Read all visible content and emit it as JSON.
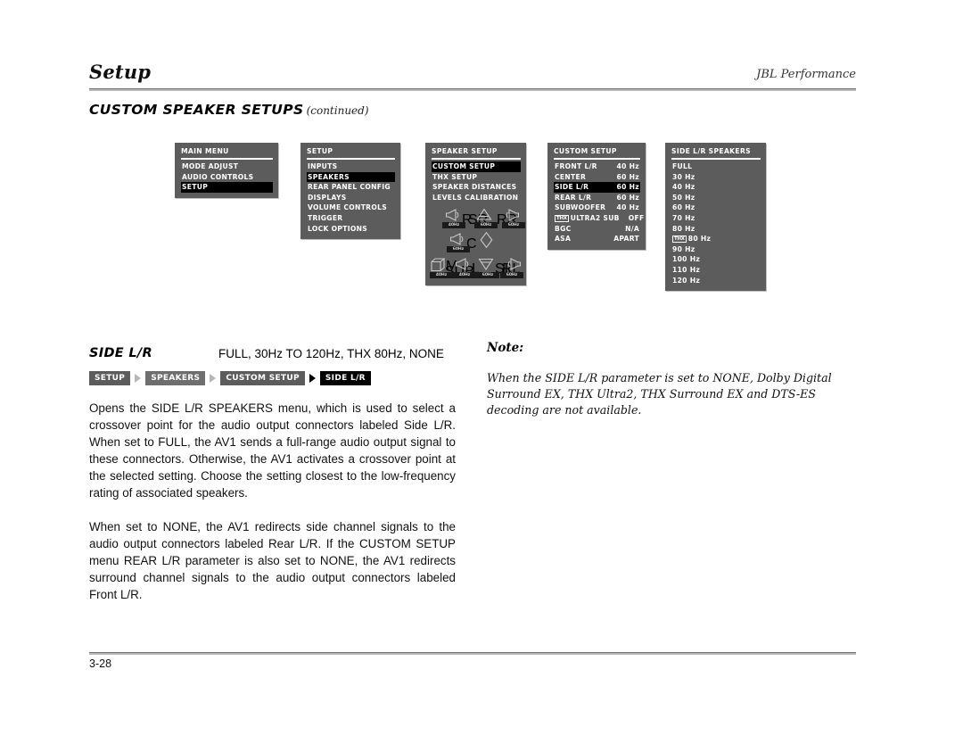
{
  "header": {
    "title": "Setup",
    "brand": "JBL Performance"
  },
  "section": {
    "heading": "CUSTOM SPEAKER SETUPS",
    "continued": "(continued)"
  },
  "menus": [
    {
      "id": "main-menu",
      "title": "MAIN MENU",
      "rows": [
        {
          "label": "MODE ADJUST",
          "value": "",
          "selected": false
        },
        {
          "label": "AUDIO CONTROLS",
          "value": "",
          "selected": false
        },
        {
          "label": "SETUP",
          "value": "",
          "selected": true
        }
      ]
    },
    {
      "id": "setup-menu",
      "title": "SETUP",
      "rows": [
        {
          "label": "INPUTS",
          "value": "",
          "selected": false
        },
        {
          "label": "SPEAKERS",
          "value": "",
          "selected": true
        },
        {
          "label": "REAR PANEL CONFIG",
          "value": "",
          "selected": false
        },
        {
          "label": "DISPLAYS",
          "value": "",
          "selected": false
        },
        {
          "label": "VOLUME CONTROLS",
          "value": "",
          "selected": false
        },
        {
          "label": "TRIGGER",
          "value": "",
          "selected": false
        },
        {
          "label": "LOCK OPTIONS",
          "value": "",
          "selected": false
        }
      ]
    },
    {
      "id": "speaker-setup-menu",
      "title": "SPEAKER SETUP",
      "rows": [
        {
          "label": "CUSTOM SETUP",
          "value": "",
          "selected": true
        },
        {
          "label": "THX SETUP",
          "value": "",
          "selected": false
        },
        {
          "label": "SPEAKER DISTANCES",
          "value": "",
          "selected": false
        },
        {
          "label": "LEVELS CALIBRATION",
          "value": "",
          "selected": false
        }
      ],
      "diagram": {
        "speakers": [
          {
            "name": "R",
            "crossover": "40Hz"
          },
          {
            "name": "SR",
            "crossover": "60Hz"
          },
          {
            "name": "RR",
            "crossover": "60Hz"
          },
          {
            "name": "C",
            "crossover": "60Hz"
          },
          {
            "name": "SUB",
            "crossover": "40Hz"
          },
          {
            "name": "L",
            "crossover": "40Hz"
          },
          {
            "name": "SL",
            "crossover": "60Hz"
          },
          {
            "name": "RL",
            "crossover": "60Hz"
          }
        ],
        "sub_prefix": "M"
      }
    },
    {
      "id": "custom-setup-menu",
      "title": "CUSTOM SETUP",
      "rows": [
        {
          "label": "FRONT L/R",
          "value": "40 Hz",
          "selected": false
        },
        {
          "label": "CENTER",
          "value": "60 Hz",
          "selected": false
        },
        {
          "label": "SIDE L/R",
          "value": "60 Hz",
          "selected": true
        },
        {
          "label": "REAR L/R",
          "value": "60 Hz",
          "selected": false
        },
        {
          "label": "SUBWOOFER",
          "value": "40 Hz",
          "selected": false
        },
        {
          "label": "ULTRA2 SUB",
          "value": "OFF",
          "selected": false,
          "badge": "THX"
        },
        {
          "label": "BGC",
          "value": "N/A",
          "selected": false
        },
        {
          "label": "ASA",
          "value": "APART",
          "selected": false
        }
      ]
    },
    {
      "id": "side-lr-speakers-menu",
      "title": "SIDE L/R SPEAKERS",
      "rows": [
        {
          "label": "FULL",
          "value": "",
          "selected": false
        },
        {
          "label": "30 Hz",
          "value": "",
          "selected": false
        },
        {
          "label": "40 Hz",
          "value": "",
          "selected": false
        },
        {
          "label": "50 Hz",
          "value": "",
          "selected": false
        },
        {
          "label": "60 Hz",
          "value": "",
          "selected": false
        },
        {
          "label": "70 Hz",
          "value": "",
          "selected": false
        },
        {
          "label": "80 Hz",
          "value": "",
          "selected": false
        },
        {
          "label": "80 Hz",
          "value": "",
          "selected": false,
          "badge": "THX"
        },
        {
          "label": "90 Hz",
          "value": "",
          "selected": false
        },
        {
          "label": "100 Hz",
          "value": "",
          "selected": false
        },
        {
          "label": "110 Hz",
          "value": "",
          "selected": false
        },
        {
          "label": "120 Hz",
          "value": "",
          "selected": false
        }
      ]
    }
  ],
  "parameter": {
    "name": "SIDE L/R",
    "values": "FULL, 30Hz TO 120Hz, THX 80Hz, NONE"
  },
  "breadcrumb": [
    {
      "label": "SETUP",
      "style": "dark"
    },
    {
      "label": "SPEAKERS",
      "style": "light"
    },
    {
      "label": "CUSTOM SETUP",
      "style": "dark"
    },
    {
      "label": "SIDE L/R",
      "style": "black"
    }
  ],
  "body": {
    "paragraphs": [
      "Opens the SIDE L/R SPEAKERS menu, which is used to select a crossover point for the audio output connectors labeled Side L/R. When set to FULL, the AV1 sends a full-range audio output signal to these connectors. Otherwise, the AV1 activates a crossover point at the selected setting. Choose the setting closest to the low-frequency rating of associated speakers.",
      "When set to NONE, the AV1 redirects side channel signals to the audio output connectors labeled Rear L/R. If the CUSTOM SETUP menu REAR L/R parameter is also set to NONE, the AV1 redirects surround channel signals to the audio output connectors labeled Front L/R."
    ]
  },
  "note": {
    "title": "Note:",
    "text": "When the SIDE L/R parameter is set to NONE, Dolby Digital Surround EX, THX Ultra2, THX Surround EX and DTS-ES decoding are not available."
  },
  "footer": {
    "page_number": "3-28"
  }
}
